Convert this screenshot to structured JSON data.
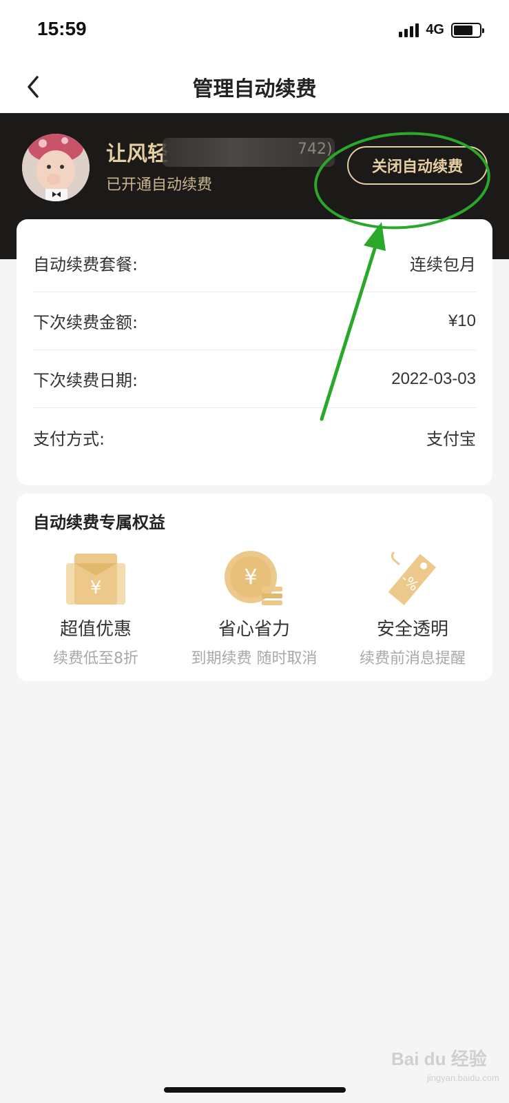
{
  "status_bar": {
    "time": "15:59",
    "network": "4G"
  },
  "nav": {
    "title": "管理自动续费"
  },
  "user": {
    "name": "让风轻",
    "id_tail": "742)",
    "status": "已开通自动续费"
  },
  "close_button_label": "关闭自动续费",
  "info": [
    {
      "label": "自动续费套餐:",
      "value": "连续包月"
    },
    {
      "label": "下次续费金额:",
      "value": "¥10"
    },
    {
      "label": "下次续费日期:",
      "value": "2022-03-03"
    },
    {
      "label": "支付方式:",
      "value": "支付宝"
    }
  ],
  "benefits": {
    "title": "自动续费专属权益",
    "items": [
      {
        "icon": "red-envelope-icon",
        "title": "超值优惠",
        "desc": "续费低至8折"
      },
      {
        "icon": "coin-icon",
        "title": "省心省力",
        "desc": "到期续费 随时取消"
      },
      {
        "icon": "discount-tag-icon",
        "title": "安全透明",
        "desc": "续费前消息提醒"
      }
    ]
  },
  "watermark": {
    "text": "Bai du 经验",
    "sub": "jingyan.baidu.com"
  },
  "colors": {
    "header_bg": "#1c1a19",
    "gold_text": "#e6cfa3",
    "icon_gold": "#ecc98a",
    "annotation_green": "#2aa82a"
  }
}
